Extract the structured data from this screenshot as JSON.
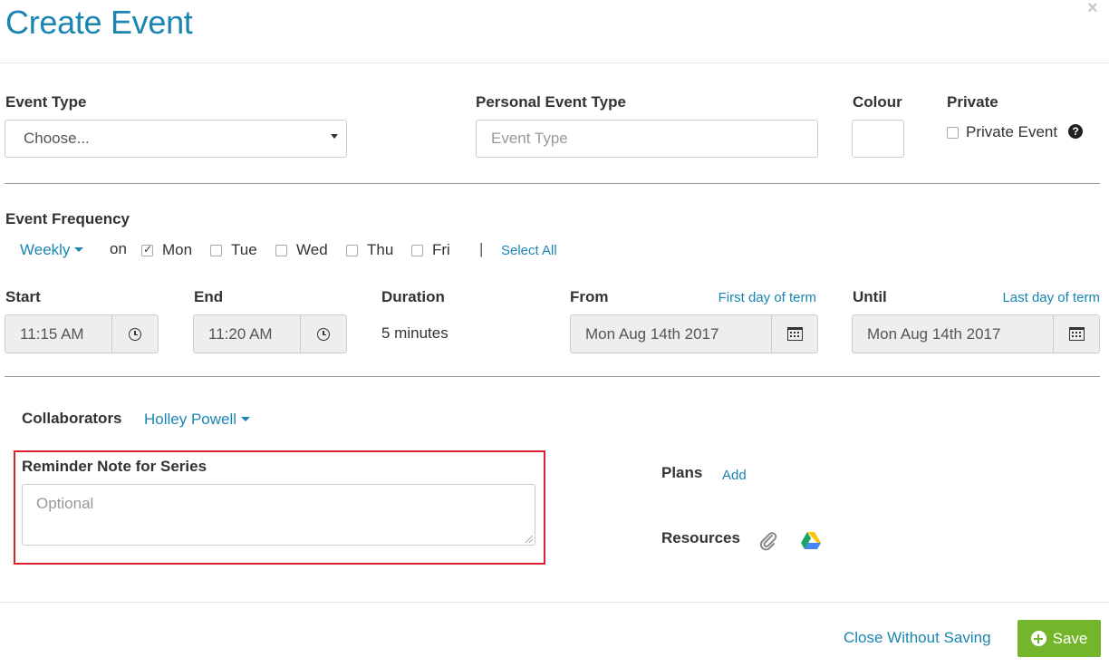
{
  "header": {
    "title": "Create Event",
    "close_label": "×"
  },
  "event_type": {
    "label": "Event Type",
    "value": "Choose..."
  },
  "personal_event_type": {
    "label": "Personal Event Type",
    "placeholder": "Event Type"
  },
  "colour": {
    "label": "Colour"
  },
  "private": {
    "label": "Private",
    "checkbox_label": "Private Event",
    "help_glyph": "?",
    "checked": false
  },
  "frequency": {
    "label": "Event Frequency",
    "value": "Weekly",
    "on_label": "on",
    "days": [
      {
        "label": "Mon",
        "checked": true
      },
      {
        "label": "Tue",
        "checked": false
      },
      {
        "label": "Wed",
        "checked": false
      },
      {
        "label": "Thu",
        "checked": false
      },
      {
        "label": "Fri",
        "checked": false
      }
    ],
    "separator": "|",
    "select_all": "Select All"
  },
  "time": {
    "start_label": "Start",
    "start_value": "11:15 AM",
    "end_label": "End",
    "end_value": "11:20 AM",
    "duration_label": "Duration",
    "duration_value": "5 minutes"
  },
  "dates": {
    "from_label": "From",
    "from_link": "First day of term",
    "from_value": "Mon Aug 14th 2017",
    "until_label": "Until",
    "until_link": "Last day of term",
    "until_value": "Mon Aug 14th 2017"
  },
  "collaborators": {
    "label": "Collaborators",
    "value": "Holley Powell"
  },
  "reminder": {
    "label": "Reminder Note for Series",
    "placeholder": "Optional"
  },
  "plans": {
    "label": "Plans",
    "add": "Add"
  },
  "resources": {
    "label": "Resources"
  },
  "footer": {
    "close_without_saving": "Close Without Saving",
    "save": "Save"
  },
  "colors": {
    "accent": "#1a85b2",
    "save_green": "#73b52b",
    "highlight_red": "#d9232d"
  },
  "icons": [
    "close-icon",
    "chevron-down-icon",
    "question-circle-icon",
    "clock-icon",
    "calendar-icon",
    "paperclip-icon",
    "google-drive-icon",
    "plus-circle-icon"
  ]
}
